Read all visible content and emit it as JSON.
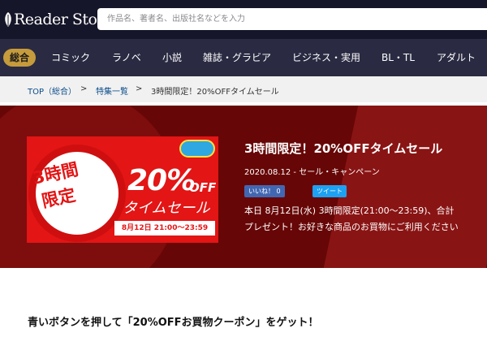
{
  "header": {
    "logo_text": "Reader Store",
    "search_placeholder": "作品名、著者名、出版社名などを入力"
  },
  "nav": {
    "items": [
      "総合",
      "コミック",
      "ラノベ",
      "小説",
      "雑誌・グラビア",
      "ビジネス・実用",
      "BL・TL",
      "アダルト"
    ],
    "active_index": 0
  },
  "breadcrumb": {
    "items": [
      "TOP（総合）",
      ">",
      "特集一覧",
      ">",
      "3時間限定！20%OFFタイムセール"
    ]
  },
  "banner": {
    "clock_line1": "3時間",
    "clock_line2": "限定",
    "percent": "20%",
    "off": "OFF",
    "sale_text": "タイムセール",
    "time_text": "8月12日 21:00～23:59"
  },
  "article": {
    "title": "3時間限定！20%OFFタイムセール",
    "meta": "2020.08.12 - セール・キャンペーン",
    "like_label": "いいね！ 0",
    "tweet_label": "ツイート",
    "desc_line1": "本日 8月12日(水) 3時間限定(21:00～23:59)、合計",
    "desc_line2": "プレゼント！お好きな商品のお買物にご利用ください"
  },
  "section": {
    "heading": "青いボタンを押して「20%OFFお買物クーポン」をゲット！"
  },
  "colors": {
    "header_bg": "#16162a",
    "nav_bg": "#2a2a42",
    "nav_active": "#c69b3c",
    "hero_bg": "#7e0a0a",
    "banner_red": "#e31515",
    "fb_blue": "#4267b2",
    "tw_blue": "#1da1f2"
  }
}
